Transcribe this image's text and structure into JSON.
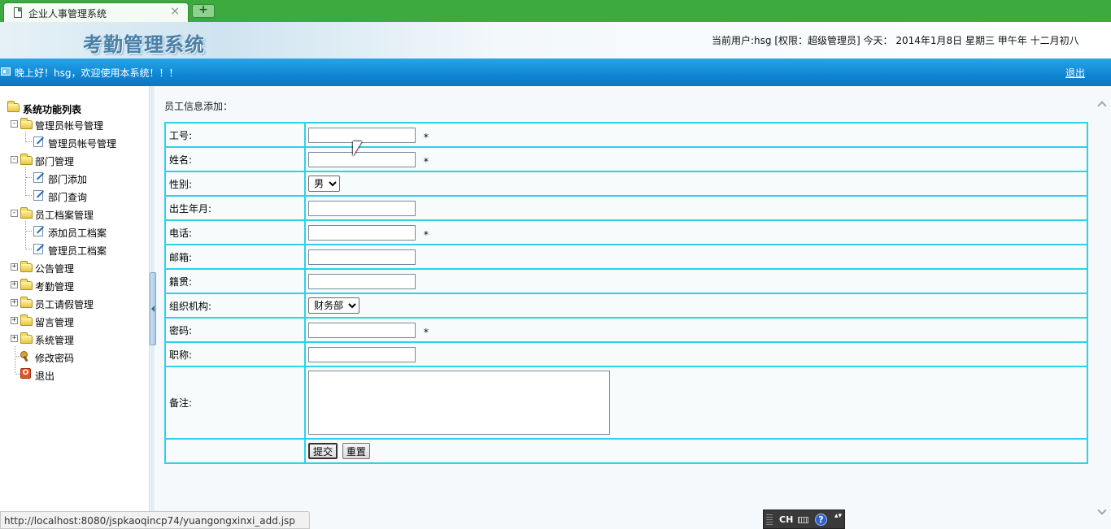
{
  "browser": {
    "tab_title": "企业人事管理系统",
    "close_glyph": "×",
    "newtab_glyph": "+",
    "status_url": "http://localhost:8080/jspkaoqincp74/yuangongxinxi_add.jsp"
  },
  "header": {
    "app_title": "考勤管理系统",
    "user_info": "当前用户:hsg [权限：超级管理员] 今天： 2014年1月8日 星期三 甲午年 十二月初八"
  },
  "welcome_bar": {
    "text": "晚上好！hsg，欢迎使用本系统！！！",
    "logout": "退出"
  },
  "sidebar": {
    "root": "系统功能列表",
    "groups": [
      {
        "label": "管理员帐号管理",
        "expanded": true,
        "toggle": "-",
        "children": [
          "管理员帐号管理"
        ]
      },
      {
        "label": "部门管理",
        "expanded": true,
        "toggle": "-",
        "children": [
          "部门添加",
          "部门查询"
        ]
      },
      {
        "label": "员工档案管理",
        "expanded": true,
        "toggle": "-",
        "children": [
          "添加员工档案",
          "管理员工档案"
        ]
      },
      {
        "label": "公告管理",
        "expanded": false,
        "toggle": "+",
        "children": []
      },
      {
        "label": "考勤管理",
        "expanded": false,
        "toggle": "+",
        "children": []
      },
      {
        "label": "员工请假管理",
        "expanded": false,
        "toggle": "+",
        "children": []
      },
      {
        "label": "留言管理",
        "expanded": false,
        "toggle": "+",
        "children": []
      },
      {
        "label": "系统管理",
        "expanded": false,
        "toggle": "+",
        "children": []
      }
    ],
    "change_password": "修改密码",
    "exit": "退出"
  },
  "main": {
    "crumb": "员工信息添加：",
    "required_mark": "*",
    "fields": {
      "employee_no": {
        "label": "工号:",
        "value": ""
      },
      "name": {
        "label": "姓名:",
        "value": ""
      },
      "gender": {
        "label": "性别:",
        "selected": "男"
      },
      "birth": {
        "label": "出生年月:",
        "value": ""
      },
      "phone": {
        "label": "电话:",
        "value": ""
      },
      "email": {
        "label": "邮箱:",
        "value": ""
      },
      "native_place": {
        "label": "籍贯:",
        "value": ""
      },
      "department": {
        "label": "组织机构:",
        "selected": "财务部"
      },
      "password": {
        "label": "密码:",
        "value": ""
      },
      "title": {
        "label": "职称:",
        "value": ""
      },
      "remark": {
        "label": "备注:",
        "value": ""
      }
    },
    "submit": "提交",
    "reset": "重置"
  },
  "langbar": {
    "lang": "CH",
    "help": "?",
    "options": "▴▾"
  },
  "colors": {
    "tab_strip": "#3daa3f",
    "welcome_bar": "#0f86d3",
    "table_border": "#2ed1e8",
    "title_text": "#4a7fa6"
  }
}
